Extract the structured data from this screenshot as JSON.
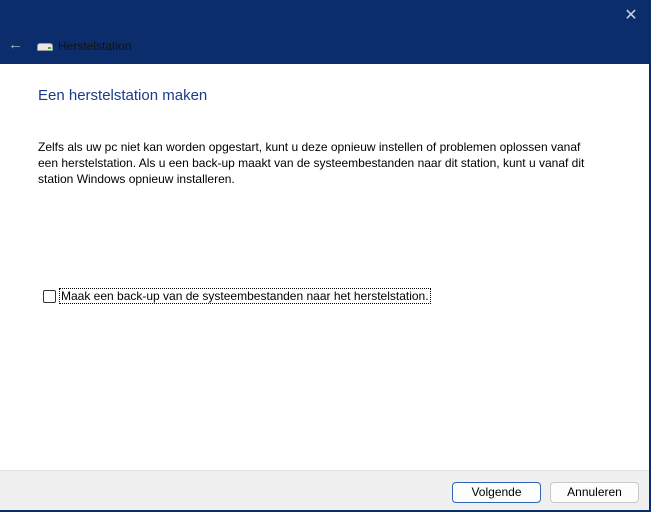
{
  "window": {
    "title": "Herstelstation",
    "close_icon": "close-icon",
    "back_icon": "back-arrow-icon"
  },
  "main": {
    "heading": "Een herstelstation maken",
    "description": "Zelfs als uw pc niet kan worden opgestart, kunt u deze opnieuw instellen of problemen oplossen vanaf een herstelstation. Als u een back-up maakt van de systeembestanden naar dit station, kunt u vanaf dit station Windows opnieuw installeren.",
    "checkbox_label": "Maak een back-up van de systeembestanden naar het herstelstation.",
    "checkbox_checked": false
  },
  "footer": {
    "next_label": "Volgende",
    "cancel_label": "Annuleren"
  }
}
